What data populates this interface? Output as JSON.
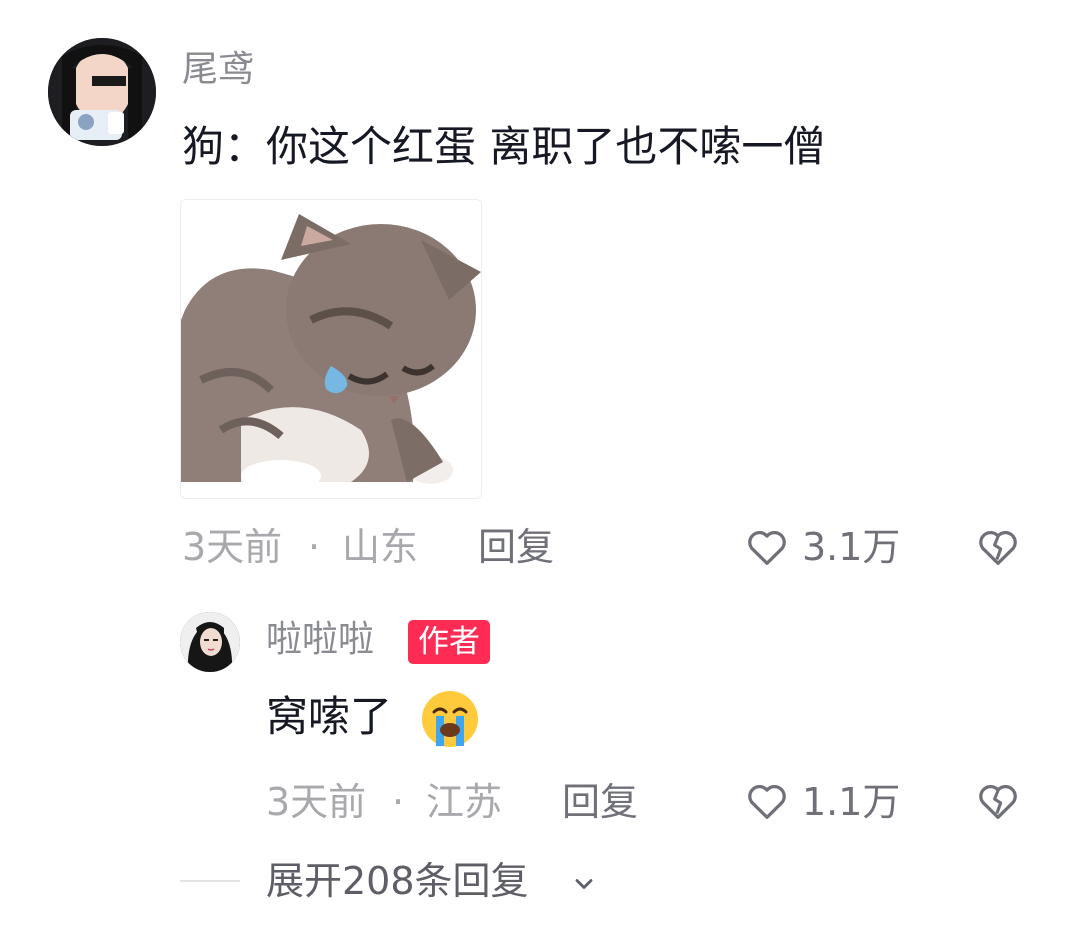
{
  "comment": {
    "username": "尾鸢",
    "text": "狗：你这个红蛋 离职了也不嗦一僧",
    "sticker": "crying-kitten-sticker",
    "time": "3天前",
    "separator": "·",
    "location": "山东",
    "reply_label": "回复",
    "likes": "3.1万"
  },
  "reply": {
    "username": "啦啦啦",
    "badge": "作者",
    "text": "窝嗦了",
    "emoji": "😭",
    "time": "3天前",
    "separator": "·",
    "location": "江苏",
    "reply_label": "回复",
    "likes": "1.1万"
  },
  "expand": {
    "label": "展开208条回复"
  },
  "colors": {
    "badge": "#fe2c55",
    "username": "#8a8b91",
    "text": "#161823",
    "meta": "#a8a8ad"
  },
  "icons": [
    "heart-outline-icon",
    "broken-heart-icon",
    "chevron-down-icon"
  ]
}
